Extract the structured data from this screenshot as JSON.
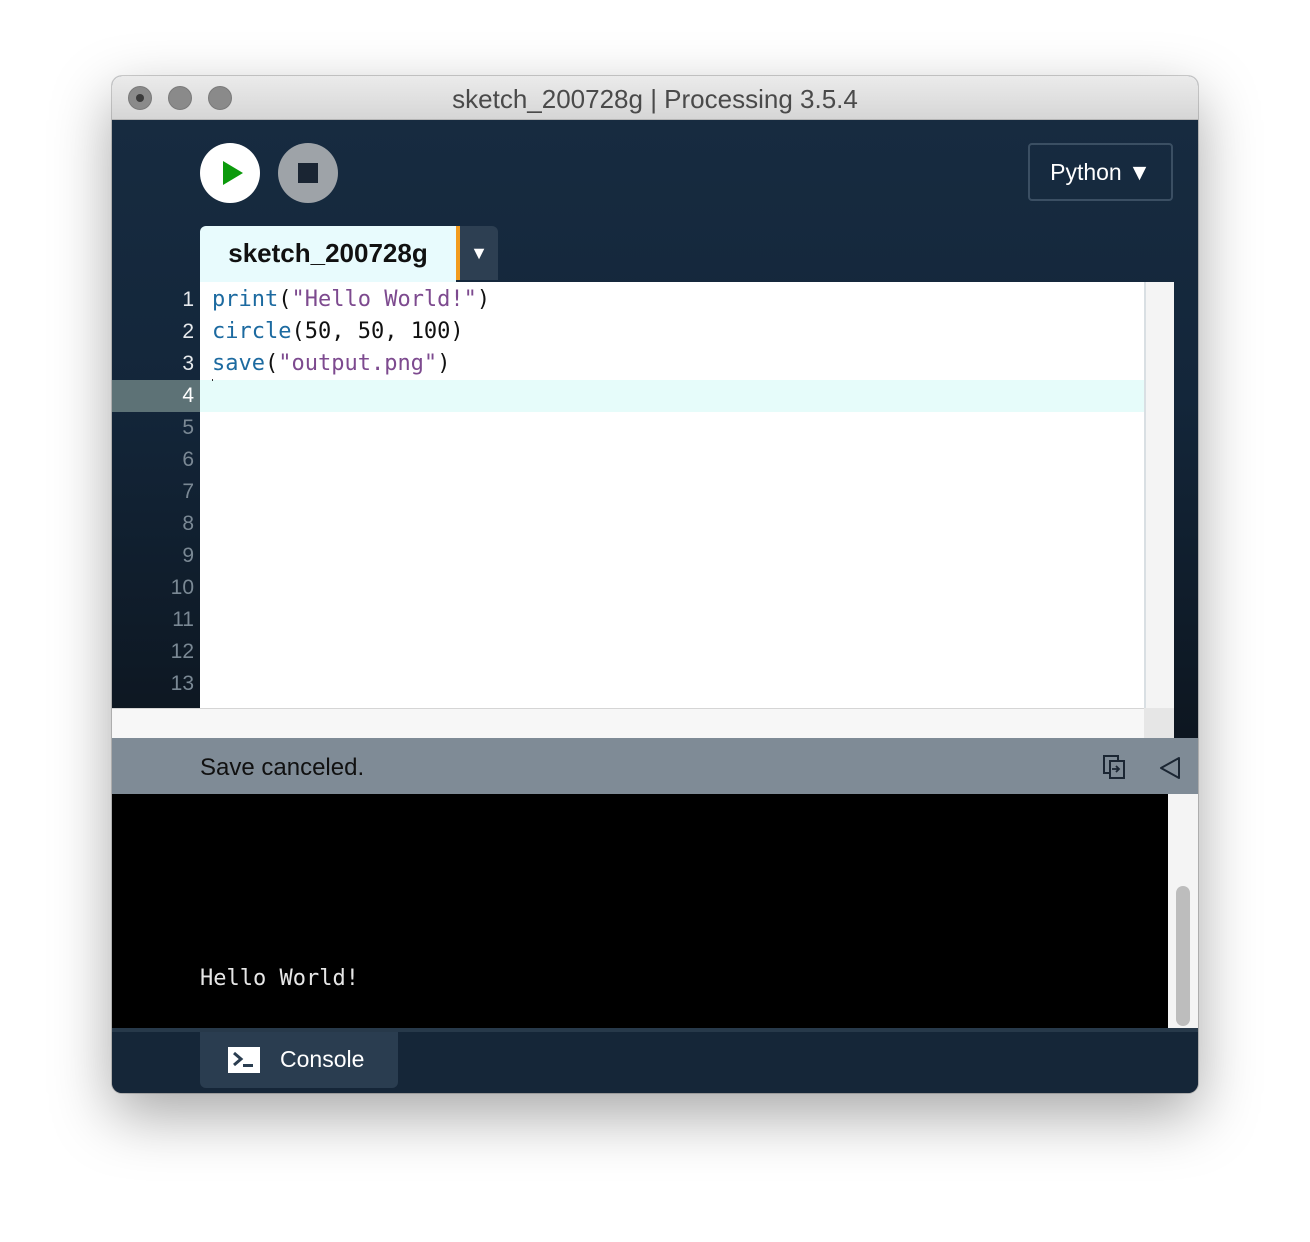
{
  "window": {
    "title": "sketch_200728g | Processing 3.5.4"
  },
  "toolbar": {
    "run_icon": "play-icon",
    "stop_icon": "stop-icon",
    "mode_label": "Python ▼"
  },
  "tabs": [
    {
      "label": "sketch_200728g",
      "menu_glyph": "▼"
    }
  ],
  "editor": {
    "line_numbers": [
      "1",
      "2",
      "3",
      "4",
      "5",
      "6",
      "7",
      "8",
      "9",
      "10",
      "11",
      "12",
      "13"
    ],
    "current_line": "4",
    "lines": [
      [
        {
          "t": "print",
          "c": "fn"
        },
        {
          "t": "(",
          "c": "pn"
        },
        {
          "t": "\"Hello World!\"",
          "c": "str"
        },
        {
          "t": ")",
          "c": "pn"
        }
      ],
      [
        {
          "t": "circle",
          "c": "fn"
        },
        {
          "t": "(50, 50, 100)",
          "c": "pn"
        }
      ],
      [
        {
          "t": "save",
          "c": "fn"
        },
        {
          "t": "(",
          "c": "pn"
        },
        {
          "t": "\"output.png\"",
          "c": "str"
        },
        {
          "t": ")",
          "c": "pn"
        }
      ]
    ]
  },
  "status": {
    "message": "Save canceled.",
    "copy_icon": "copy-icon",
    "collapse_icon": "collapse-triangle-icon"
  },
  "console": {
    "output": "Hello World!"
  },
  "footer": {
    "console_tab_label": "Console",
    "console_tab_icon": "terminal-icon"
  },
  "colors": {
    "background": "#152638",
    "run_green": "#0c9a0c",
    "tab_bg": "#e8fbfd",
    "tab_accent": "#f29b1d",
    "keyword": "#1c6aa0",
    "string": "#7d4a8f",
    "status_bar": "#7f8b96",
    "console_bg": "#000000"
  }
}
